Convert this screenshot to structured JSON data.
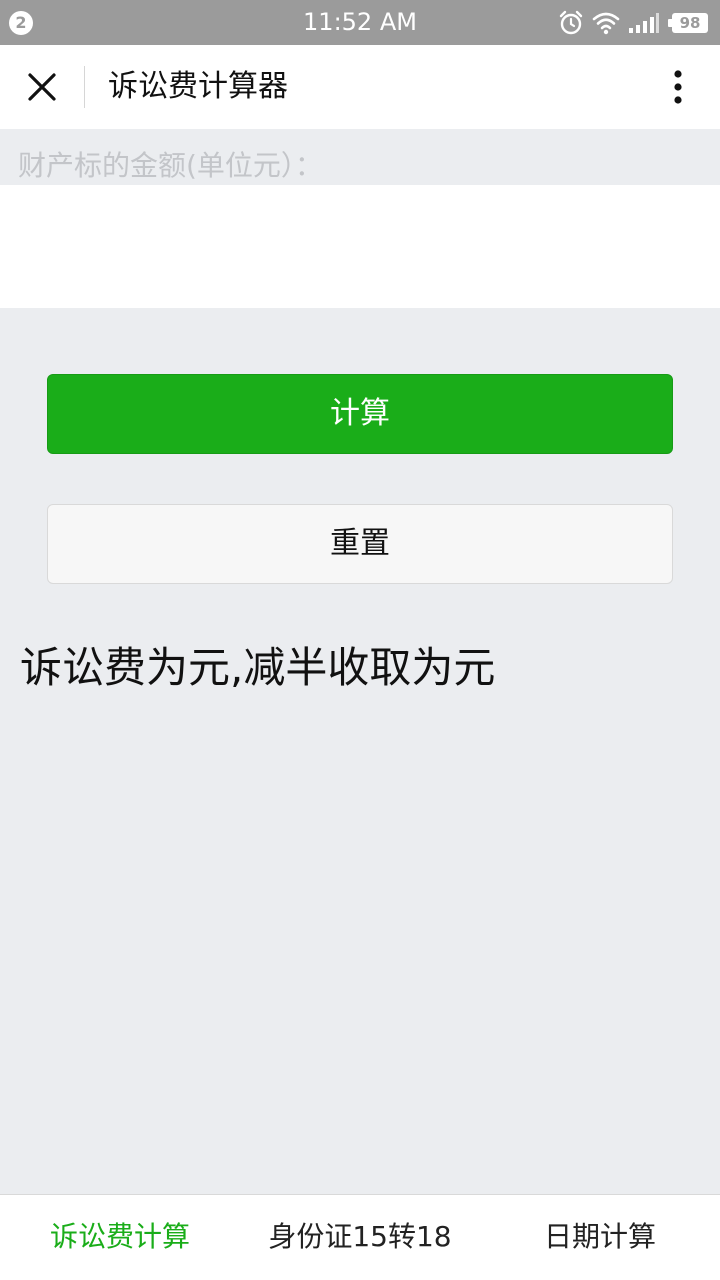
{
  "status_bar": {
    "notification_count": "2",
    "time": "11:52 AM",
    "battery": "98",
    "icons": [
      "alarm-icon",
      "wifi-icon",
      "signal-icon",
      "battery-icon"
    ]
  },
  "header": {
    "title": "诉讼费计算器",
    "left_icon": "close-icon",
    "right_icon": "more-vertical-icon"
  },
  "form": {
    "amount_label": "财产标的金额(单位元）：",
    "amount_value": ""
  },
  "buttons": {
    "calculate": "计算",
    "reset": "重置"
  },
  "result": {
    "text": "诉讼费为元,减半收取为元"
  },
  "tabs": [
    {
      "label": "诉讼费计算",
      "active": true
    },
    {
      "label": "身份证15转18",
      "active": false
    },
    {
      "label": "日期计算",
      "active": false
    }
  ],
  "colors": {
    "accent": "#1aad19",
    "status_bar": "#9b9b9b",
    "background": "#ebedf0"
  }
}
